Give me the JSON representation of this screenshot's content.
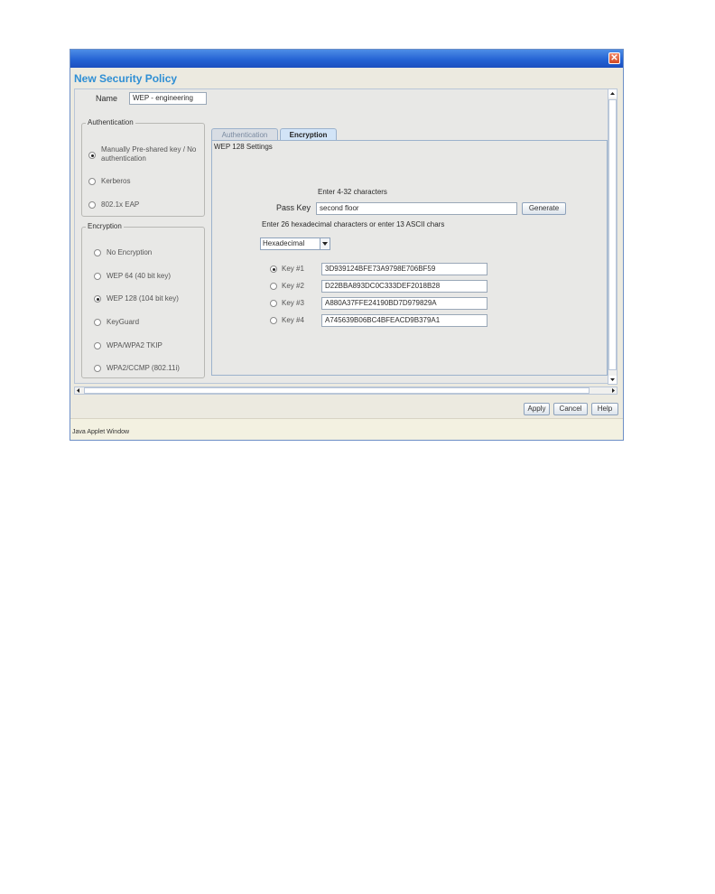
{
  "window": {
    "close_glyph": "✕",
    "title": "New Security Policy",
    "status_text": "Java Applet Window"
  },
  "name": {
    "label": "Name",
    "value": "WEP - engineering"
  },
  "authentication": {
    "title": "Authentication",
    "options": [
      {
        "label": "Manually Pre-shared key / No authentication",
        "selected": true
      },
      {
        "label": "Kerberos",
        "selected": false
      },
      {
        "label": "802.1x EAP",
        "selected": false
      }
    ]
  },
  "encryption": {
    "title": "Encryption",
    "options": [
      {
        "label": "No Encryption",
        "selected": false
      },
      {
        "label": "WEP 64 (40 bit key)",
        "selected": false
      },
      {
        "label": "WEP 128 (104 bit key)",
        "selected": true
      },
      {
        "label": "KeyGuard",
        "selected": false
      },
      {
        "label": "WPA/WPA2 TKIP",
        "selected": false
      },
      {
        "label": "WPA2/CCMP (802.11i)",
        "selected": false
      }
    ]
  },
  "tabs": [
    {
      "label": "Authentication",
      "active": false
    },
    {
      "label": "Encryption",
      "active": true
    }
  ],
  "wep": {
    "settings_title": "WEP 128 Settings",
    "passkey_hint": "Enter 4-32 characters",
    "passkey_label": "Pass Key",
    "passkey_value": "second floor",
    "generate_label": "Generate",
    "hex_hint": "Enter 26 hexadecimal characters or enter 13 ASCII chars",
    "format_value": "Hexadecimal",
    "keys": [
      {
        "label": "Key #1",
        "value": "3D939124BFE73A9798E706BF59",
        "selected": true
      },
      {
        "label": "Key #2",
        "value": "D22BBA893DC0C333DEF2018B28",
        "selected": false
      },
      {
        "label": "Key #3",
        "value": "A880A37FFE24190BD7D979829A",
        "selected": false
      },
      {
        "label": "Key #4",
        "value": "A745639B06BC4BFEACD9B379A1",
        "selected": false
      }
    ]
  },
  "buttons": {
    "apply": "Apply",
    "cancel": "Cancel",
    "help": "Help"
  },
  "colors": {
    "title_bar": "#2563d4",
    "dialog_title": "#2f8fd4",
    "close_button": "#d34a24"
  }
}
